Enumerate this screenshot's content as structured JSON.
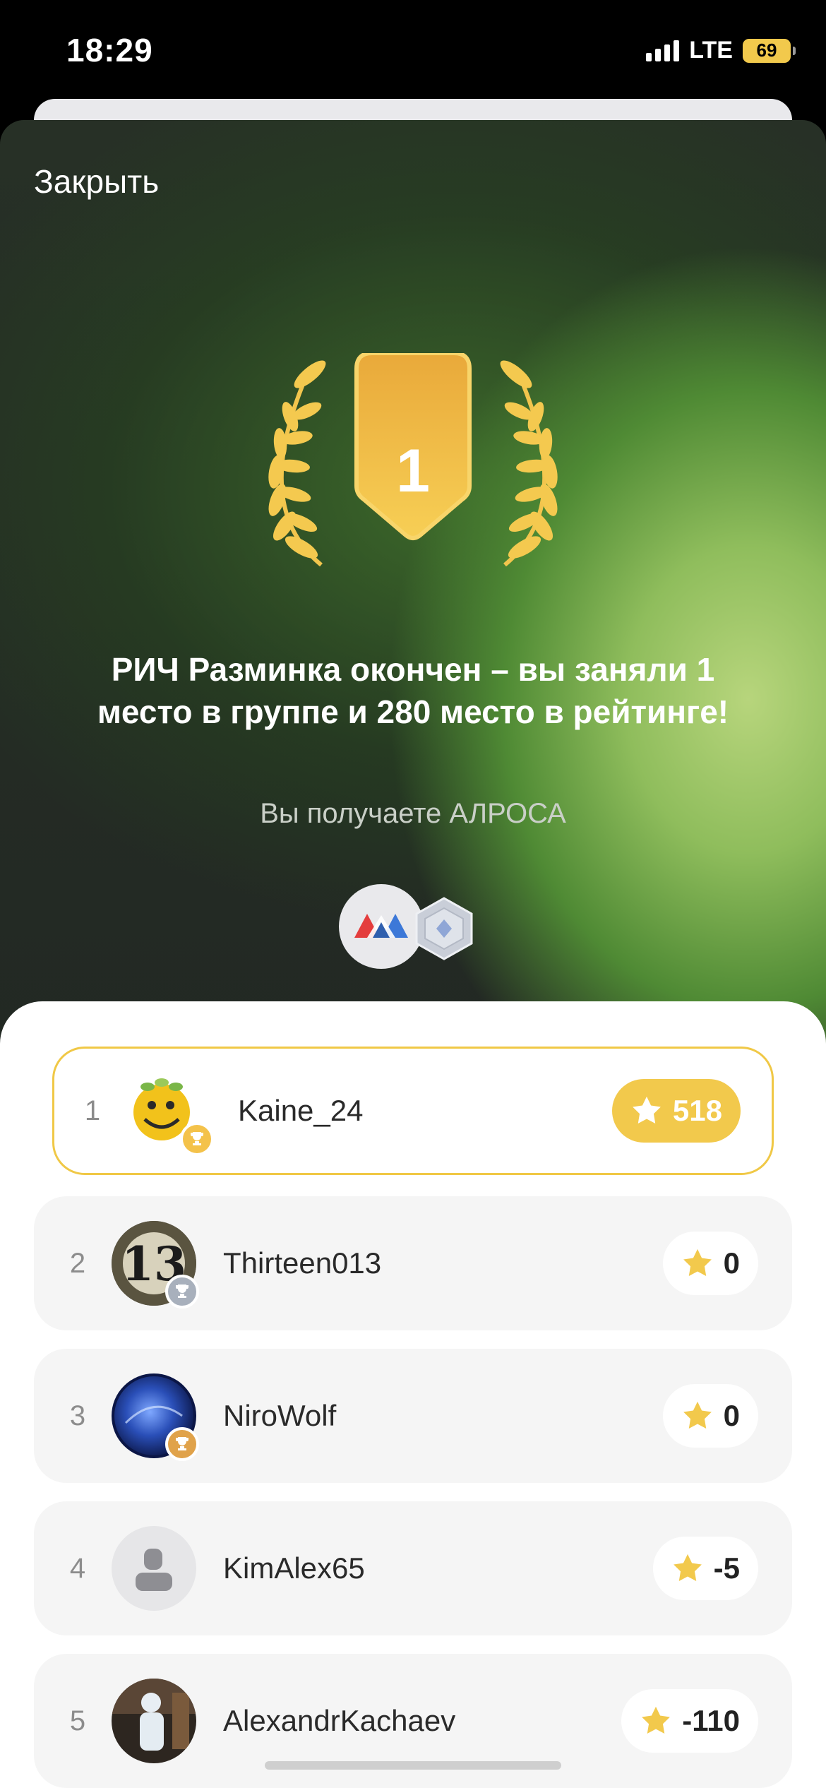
{
  "status_bar": {
    "time": "18:29",
    "network": "LTE",
    "battery": "69"
  },
  "header": {
    "close_label": "Закрыть"
  },
  "award": {
    "place": "1"
  },
  "result": {
    "headline": "РИЧ Разминка окончен – вы заняли 1 место в группе и 280 место в рейтинге!",
    "subline": "Вы получаете АЛРОСА"
  },
  "leaderboard": {
    "rows": [
      {
        "rank": "1",
        "name": "Kaine_24",
        "score": "518",
        "trophy": "gold"
      },
      {
        "rank": "2",
        "name": "Thirteen013",
        "score": "0",
        "trophy": "silver"
      },
      {
        "rank": "3",
        "name": "NiroWolf",
        "score": "0",
        "trophy": "bronze"
      },
      {
        "rank": "4",
        "name": "KimAlex65",
        "score": "-5",
        "trophy": "none"
      },
      {
        "rank": "5",
        "name": "AlexandrKachaev",
        "score": "-110",
        "trophy": "none"
      }
    ]
  },
  "colors": {
    "accent": "#F2C94C",
    "gold_shield": "#F4C24A",
    "silver": "#A8B0BC",
    "bronze": "#E0A24A"
  }
}
